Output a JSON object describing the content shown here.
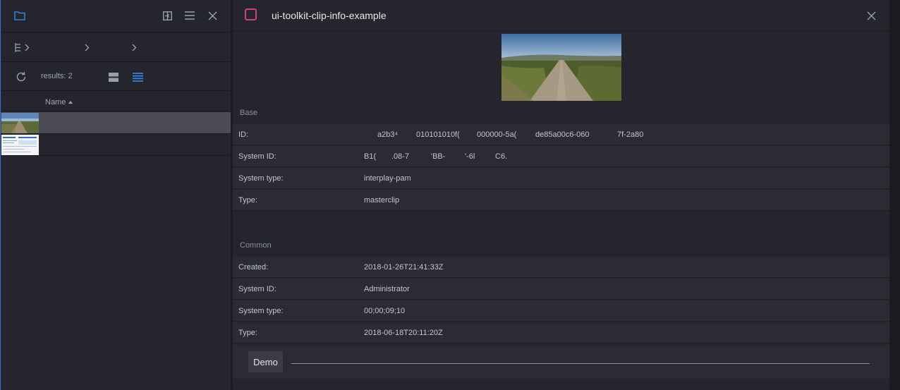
{
  "left_panel": {
    "results": "results: 2",
    "column_name": "Name",
    "items": [
      {
        "thumbnail": "road-landscape"
      },
      {
        "thumbnail": "document-page"
      }
    ]
  },
  "right_panel": {
    "title": "ui-toolkit-clip-info-example",
    "base": {
      "heading": "Base",
      "rows": [
        {
          "label": "ID:",
          "fragments": [
            "a2b3⁴",
            "010101010f(",
            "000000-5a(",
            "de85a00c6-060",
            "7f-2a80"
          ]
        },
        {
          "label": "System ID:",
          "fragments": [
            "B1(",
            ".08-7",
            "'BB-",
            "'-6l",
            "C6."
          ]
        },
        {
          "label": "System type:",
          "value": "interplay-pam"
        },
        {
          "label": "Type:",
          "value": "masterclip"
        }
      ]
    },
    "common": {
      "heading": "Common",
      "rows": [
        {
          "label": "Created:",
          "value": "2018-01-26T21:41:33Z"
        },
        {
          "label": "System ID:",
          "value": "Administrator"
        },
        {
          "label": "System type:",
          "value": "00;00;09;10"
        },
        {
          "label": "Type:",
          "value": "2018-06-18T20:11:20Z"
        }
      ]
    },
    "demo_label": "Demo"
  },
  "icons": {
    "folder": "folder-icon",
    "layout": "layout-icon",
    "menu": "menu-icon",
    "close": "close-icon",
    "tree": "tree-icon",
    "chevron": "chevron-right-icon",
    "refresh": "refresh-icon",
    "grid_view": "grid-view-icon",
    "list_view": "list-view-icon"
  },
  "colors": {
    "accent_blue": "#3b7ddd",
    "title_square": "#d0407a",
    "selected_row": "#4b4c53"
  }
}
